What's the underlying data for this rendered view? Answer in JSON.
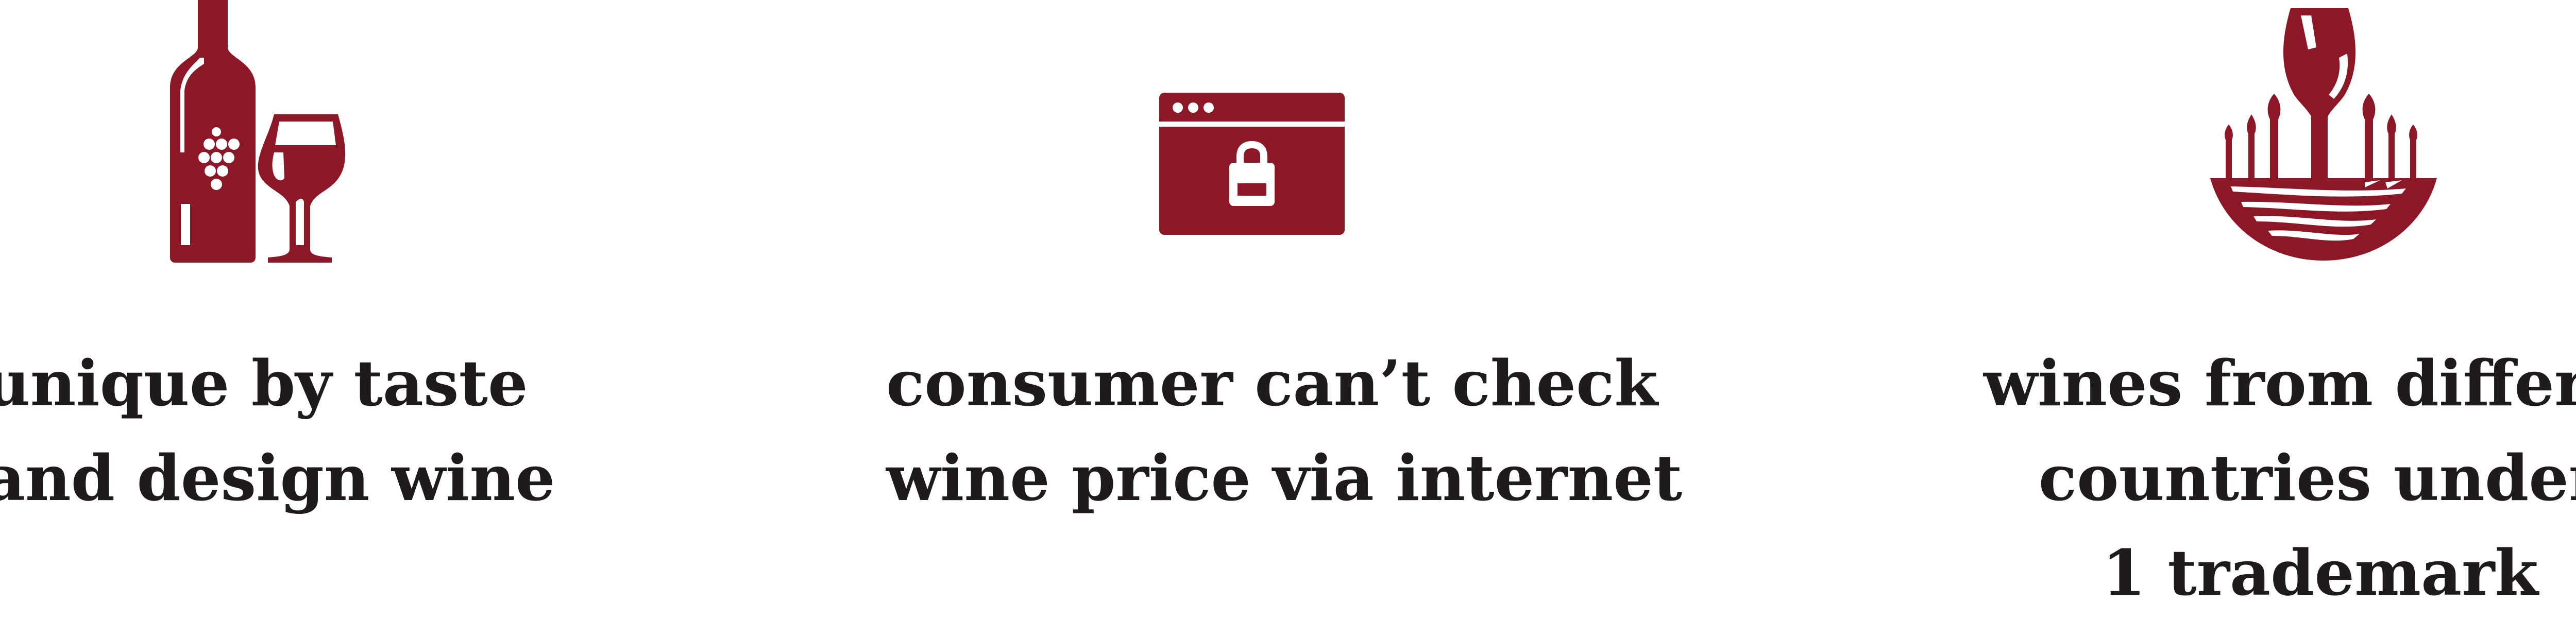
{
  "theme": {
    "accent": "#8b1727",
    "text": "#1f1a1c",
    "background": "#ffffff"
  },
  "features": [
    {
      "icon": "wine-bottle-and-glass-icon",
      "lines": [
        "unique by taste",
        "and design wine"
      ]
    },
    {
      "icon": "browser-lock-icon",
      "lines": [
        "consumer can’t check",
        "wine price via internet"
      ]
    },
    {
      "icon": "wine-glass-vineyard-icon",
      "lines": [
        "wines from different",
        "countries under",
        "1 trademark"
      ]
    }
  ]
}
